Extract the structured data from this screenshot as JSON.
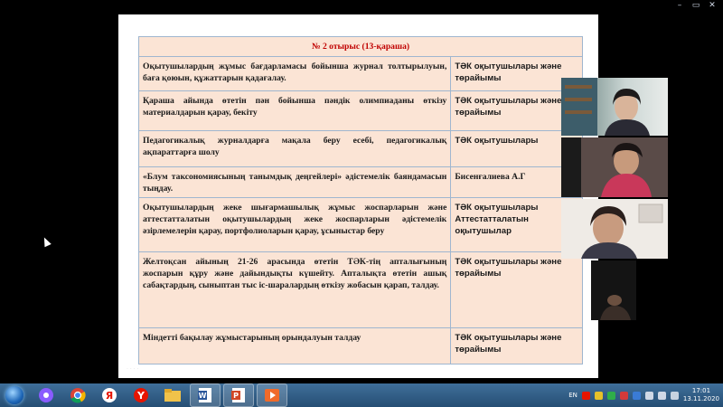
{
  "window_controls": {
    "minimize": "–",
    "maximize": "▭",
    "close": "✕"
  },
  "slide": {
    "header": "№ 2 отырыс (13-қараша)",
    "rows": [
      {
        "task": "Оқытушылардың жұмыс бағдарламасы бойынша журнал толтырылуын, баға қоюын, құжаттарын қадағалау.",
        "responsible": "ТӘК оқытушылары және төрайымы"
      },
      {
        "task": "Қараша айында өтетін пән бойынша пәндік олимпиаданы өткізу материалдарын қарау, бекіту",
        "responsible": "ТӘК оқытушылары және төрайымы"
      },
      {
        "task": "Педагогикалық журналдарға мақала беру есебі, педагогикалық ақпараттарға шолу",
        "responsible": "ТӘК оқытушылары"
      },
      {
        "task": "«Блум таксономиясының танымдық деңгейлері» әдістемелік баяндамасын тыңдау.",
        "responsible": "Бисенғалиева А.Г"
      },
      {
        "task": "Оқытушылардың жеке шығармашылық жұмыс жоспарларын және аттестатталатын оқытушылардың жеке жоспарларын әдістемелік әзірлемелерін қарау, портфолиоларын қарау, ұсыныстар беру",
        "responsible": "ТӘК оқытушылары Аттестатталатын оқытушылар"
      },
      {
        "task": "Желтоқсан айының 21-26 арасында өтетін ТӘК-тің апталығының жоспарын құру және дайындықты күшейту. Апталықта өтетін ашық сабақтардың, сыныптан тыс іс-шаралардың өткізу жобасын қарап, талдау.",
        "responsible": "ТӘК оқытушылары және төрайымы"
      },
      {
        "task": "Міндетті бақылау жұмыстарының орындалуын талдау",
        "responsible": "ТӘК оқытушылары және төрайымы"
      }
    ]
  },
  "participants": [
    "participant-video-1",
    "participant-video-2",
    "participant-video-3",
    "participant-video-4"
  ],
  "taskbar": {
    "apps": [
      "alice-icon",
      "chrome-icon",
      "yandex-browser-icon",
      "yandex-icon",
      "file-explorer-icon",
      "word-icon",
      "powerpoint-icon",
      "media-player-icon"
    ],
    "language": "EN",
    "time": "17:01",
    "date": "13.11.2020"
  },
  "colors": {
    "table_bg": "#fbe4d5",
    "header_text": "#c00000",
    "border": "#9fb6cf",
    "taskbar": "#2f5d88"
  }
}
